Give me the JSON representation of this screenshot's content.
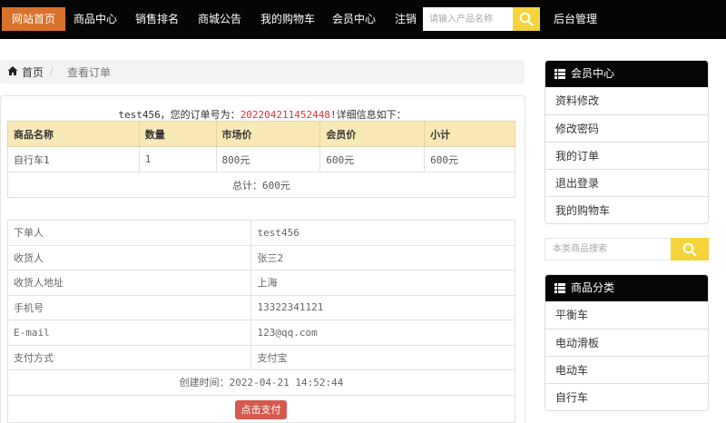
{
  "nav": {
    "items": [
      {
        "label": "网站首页"
      },
      {
        "label": "商品中心"
      },
      {
        "label": "销售排名"
      },
      {
        "label": "商城公告"
      },
      {
        "label": "我的购物车"
      },
      {
        "label": "会员中心"
      },
      {
        "label": "注销"
      }
    ],
    "search_placeholder": "请输入产品名称",
    "admin_label": "后台管理",
    "active_color": "#d9712b",
    "accent_color": "#f5d43b"
  },
  "breadcrumb": {
    "home": "首页",
    "separator": "/",
    "current": "查看订单"
  },
  "order": {
    "intro_prefix": "test456，您的订单号为：",
    "order_number": "202204211452448",
    "intro_suffix": "!详细信息如下：",
    "columns": [
      "商品名称",
      "数量",
      "市场价",
      "会员价",
      "小计"
    ],
    "rows": [
      [
        "自行车1",
        "1",
        "800元",
        "600元",
        "600元"
      ]
    ],
    "total": "总计：600元",
    "info": [
      {
        "label": "下单人",
        "value": "test456"
      },
      {
        "label": "收货人",
        "value": "张三2"
      },
      {
        "label": "收货人地址",
        "value": "上海"
      },
      {
        "label": "手机号",
        "value": "13322341121"
      },
      {
        "label": "E-mail",
        "value": "123@qq.com"
      },
      {
        "label": "支付方式",
        "value": "支付宝"
      }
    ],
    "created": "创建时间：2022-04-21 14:52:44",
    "pay_button": "点击支付"
  },
  "sidebar": {
    "member": {
      "title": "会员中心",
      "items": [
        "资料修改",
        "修改密码",
        "我的订单",
        "退出登录",
        "我的购物车"
      ]
    },
    "search_placeholder": "本类商品搜索",
    "category": {
      "title": "商品分类",
      "items": [
        "平衡车",
        "电动滑板",
        "电动车",
        "自行车"
      ]
    }
  }
}
